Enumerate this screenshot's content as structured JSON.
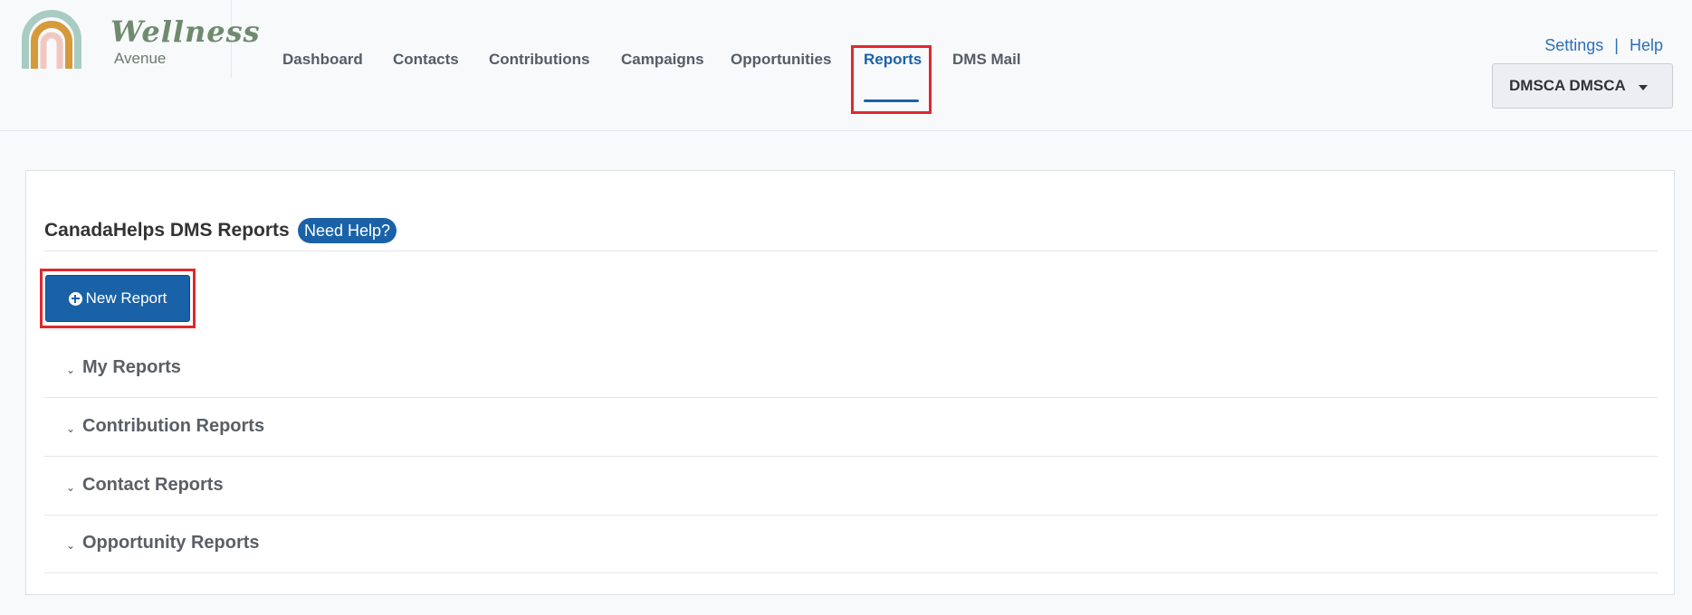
{
  "logo": {
    "word": "Wellness",
    "sub": "Avenue"
  },
  "nav": [
    {
      "label": "Dashboard"
    },
    {
      "label": "Contacts"
    },
    {
      "label": "Contributions"
    },
    {
      "label": "Campaigns"
    },
    {
      "label": "Opportunities"
    },
    {
      "label": "Reports",
      "active": true
    },
    {
      "label": "DMS Mail"
    }
  ],
  "toplinks": {
    "settings": "Settings",
    "separator": "|",
    "help": "Help"
  },
  "user_menu": {
    "label": "DMSCA DMSCA"
  },
  "reports_panel": {
    "title": "CanadaHelps DMS Reports",
    "help_label": "Need Help?",
    "new_report_label": "New Report",
    "sections": [
      {
        "label": "My Reports"
      },
      {
        "label": "Contribution Reports"
      },
      {
        "label": "Contact Reports"
      },
      {
        "label": "Opportunity Reports"
      }
    ]
  },
  "colors": {
    "accent": "#1a62a8",
    "highlight": "#e0282d",
    "link": "#2d6fb5"
  },
  "icons": {
    "new_report": "plus-circle-icon",
    "section_toggle": "chevron-down-icon",
    "user_menu": "caret-down-icon"
  }
}
